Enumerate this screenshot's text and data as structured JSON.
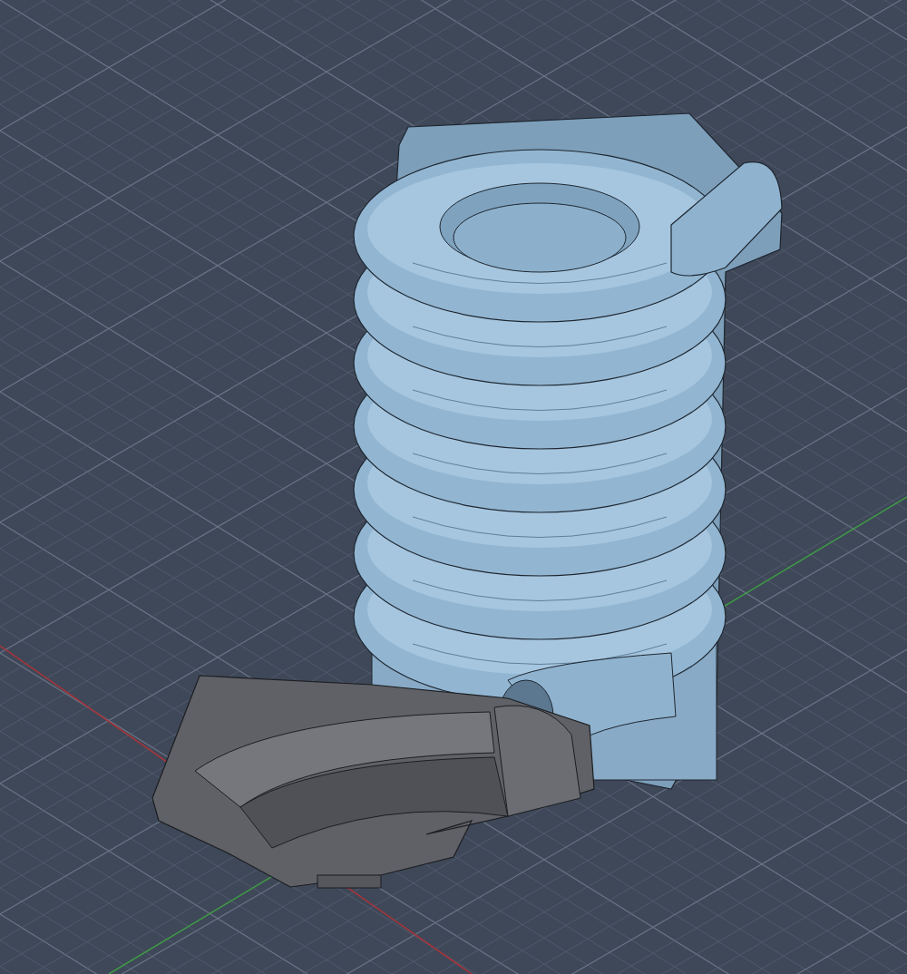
{
  "viewport": {
    "grid": true,
    "axes": [
      {
        "kind": "x",
        "color": "#a8343a"
      },
      {
        "kind": "y",
        "color": "#3f9a45"
      }
    ]
  }
}
